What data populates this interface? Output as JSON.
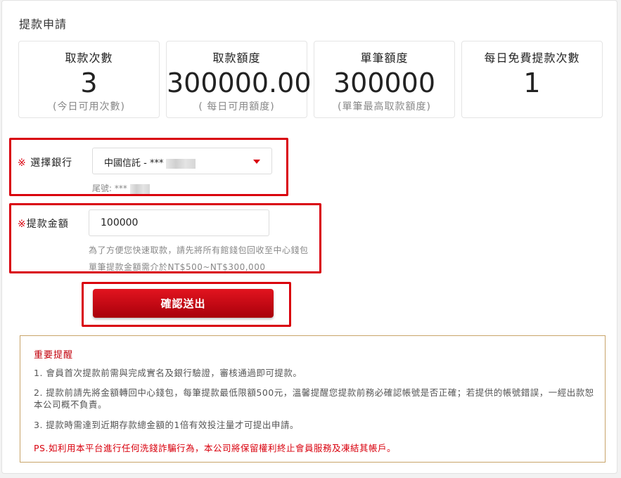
{
  "page": {
    "title": "提款申請"
  },
  "stats": [
    {
      "label": "取款次數",
      "value": "3",
      "sub": "(今日可用次數)"
    },
    {
      "label": "取款額度",
      "value": "300000.00",
      "sub": "( 每日可用額度)"
    },
    {
      "label": "單筆額度",
      "value": "300000",
      "sub": "(單筆最高取款額度)"
    },
    {
      "label": "每日免費提款次數",
      "value": "1",
      "sub": ""
    }
  ],
  "bank": {
    "mark": "※",
    "label": " 選擇銀行",
    "selected": "中國信託 - ***",
    "tail_label": "尾號: ***"
  },
  "amount": {
    "mark": "※",
    "label": "提款金額",
    "value": "100000",
    "hint1": "為了方便您快速取款，請先將所有館錢包回收至中心錢包",
    "hint2": "單筆提款金額需介於NT$500~NT$300,000"
  },
  "submit": {
    "label": "確認送出"
  },
  "notice": {
    "title": "重要提醒",
    "items": [
      "1. 會員首次提款前需與完成實名及銀行驗證，審核通過即可提款。",
      "2. 提款前請先將金額轉回中心錢包，每筆提款最低限額500元，溫馨提醒您提款前務必確認帳號是否正確；若提供的帳號錯誤，一經出款恕本公司概不負責。",
      "3. 提款時需達到近期存款總金額的1倍有效投注量才可提出申請。"
    ],
    "ps": "PS.如利用本平台進行任何洗錢詐騙行為，本公司將保留權利終止會員服務及凍結其帳戶。"
  },
  "colors": {
    "accent": "#d9000d",
    "notice_border": "#c8a46a"
  }
}
